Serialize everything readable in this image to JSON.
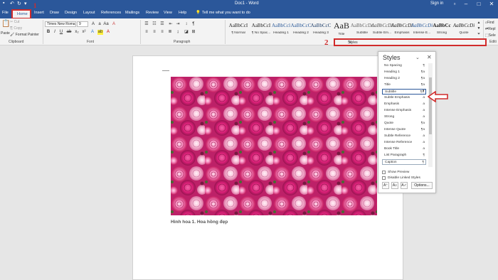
{
  "window": {
    "title": "Doc1 - Word",
    "sign_in": "Sign in"
  },
  "tabs": [
    "File",
    "Home",
    "Insert",
    "Draw",
    "Design",
    "Layout",
    "References",
    "Mailings",
    "Review",
    "View",
    "Help"
  ],
  "tell_me": "Tell me what you want to do",
  "clipboard": {
    "paste": "Paste",
    "cut": "Cut",
    "copy": "Copy",
    "format_painter": "Format Painter",
    "group": "Clipboard"
  },
  "font": {
    "name": "Times New Roma",
    "size": "9",
    "group": "Font"
  },
  "paragraph": {
    "group": "Paragraph"
  },
  "styles_gallery": [
    {
      "sample": "AaBbCcI",
      "name": "¶ Normal"
    },
    {
      "sample": "AaBbCcI",
      "name": "¶ No Spac..."
    },
    {
      "sample": "AaBbCcl",
      "name": "Heading 1"
    },
    {
      "sample": "AaBbCcC",
      "name": "Heading 2"
    },
    {
      "sample": "AaBbCcC",
      "name": "Heading 3"
    },
    {
      "sample": "AaB",
      "name": "Title"
    },
    {
      "sample": "AaBbCcDc",
      "name": "Subtitle"
    },
    {
      "sample": "AaBbCcDi",
      "name": "Subtle Em..."
    },
    {
      "sample": "AaBbCcDi",
      "name": "Emphasis"
    },
    {
      "sample": "AaBbCcDi",
      "name": "Intense E..."
    },
    {
      "sample": "AaBbCc",
      "name": "Strong"
    },
    {
      "sample": "AaBbCcDi",
      "name": "Quote"
    }
  ],
  "styles_group_label": "Styles",
  "editing": {
    "find": "Find",
    "replace": "Repl",
    "select": "Sele",
    "group": "Editi"
  },
  "annotations": {
    "one": "1",
    "two": "2"
  },
  "document": {
    "caption": "Hình hoa 1. Hoa hồng đẹp"
  },
  "styles_pane": {
    "title": "Styles",
    "items": [
      {
        "label": "No Spacing",
        "mark": "¶"
      },
      {
        "label": "Heading 1",
        "mark": "¶a"
      },
      {
        "label": "Heading 2",
        "mark": "¶a"
      },
      {
        "label": "Title",
        "mark": "¶a"
      },
      {
        "label": "Subtitle",
        "mark": "¶a"
      },
      {
        "label": "Subtle Emphasis",
        "mark": "a"
      },
      {
        "label": "Emphasis",
        "mark": "a"
      },
      {
        "label": "Intense Emphasis",
        "mark": "a"
      },
      {
        "label": "Strong",
        "mark": "a"
      },
      {
        "label": "Quote",
        "mark": "¶a"
      },
      {
        "label": "Intense Quote",
        "mark": "¶a"
      },
      {
        "label": "Subtle Reference",
        "mark": "a"
      },
      {
        "label": "Intense Reference",
        "mark": "a"
      },
      {
        "label": "Book Title",
        "mark": "a"
      },
      {
        "label": "List Paragraph",
        "mark": "¶"
      },
      {
        "label": "Caption",
        "mark": "¶"
      }
    ],
    "show_preview": "Show Preview",
    "disable_linked": "Disable Linked Styles",
    "options": "Options..."
  },
  "colors": {
    "accent": "#2b579a",
    "annotation": "#d12b2b"
  }
}
